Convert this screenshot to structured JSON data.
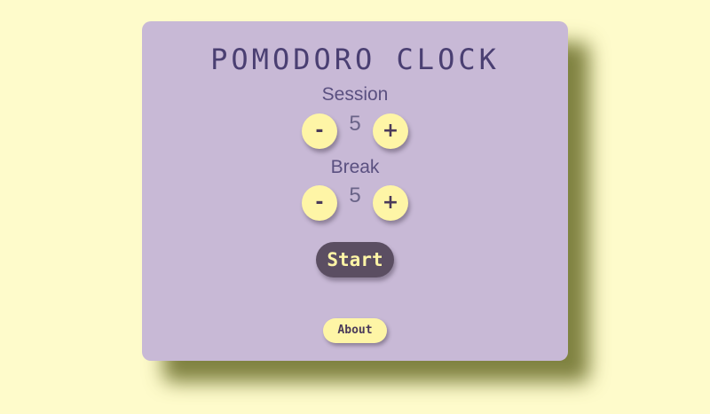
{
  "app": {
    "title": "POMODORO CLOCK"
  },
  "session": {
    "label": "Session",
    "value": "5",
    "decrement_label": "-",
    "increment_label": "+"
  },
  "break": {
    "label": "Break",
    "value": "5",
    "decrement_label": "-",
    "increment_label": "+"
  },
  "controls": {
    "start_label": "Start",
    "about_label": "About"
  },
  "colors": {
    "page_background": "#fefbcb",
    "card_background": "#c8b9d6",
    "button_yellow": "#fef5a6",
    "start_button": "#5b4e62",
    "title_text": "#4a3f72"
  }
}
